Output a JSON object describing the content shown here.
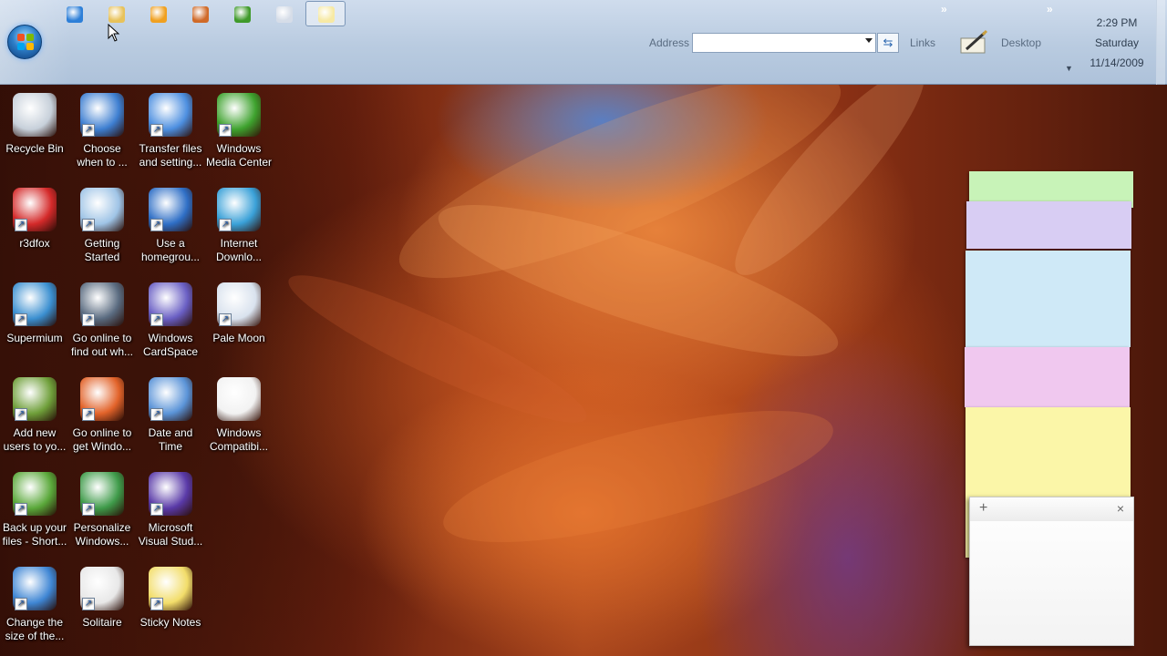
{
  "taskbar": {
    "quick_launch": [
      {
        "icon": "internet-explorer-icon",
        "color": "#2d7fd8"
      },
      {
        "icon": "windows-explorer-icon",
        "color": "#e8c25a"
      },
      {
        "icon": "media-player-icon",
        "color": "#f0a020"
      },
      {
        "icon": "firefox-icon",
        "color": "#d06a28"
      },
      {
        "icon": "media-center-icon",
        "color": "#3f9a2a"
      },
      {
        "icon": "pale-moon-icon",
        "color": "#d6dde8"
      },
      {
        "icon": "sticky-notes-icon",
        "color": "#f0d85a"
      }
    ],
    "address_label": "Address",
    "address_value": "",
    "links_label": "Links",
    "desktop_label": "Desktop",
    "chevron": "»",
    "clock": {
      "time": "2:29 PM",
      "day": "Saturday",
      "date": "11/14/2009"
    }
  },
  "desktop_icons": [
    {
      "label": "Recycle Bin",
      "icon": "recycle-bin-icon",
      "color": "#c7d0da",
      "shortcut": false
    },
    {
      "label": "Choose\nwhen to ...",
      "icon": "security-shield-icon",
      "color": "#3e7fd1",
      "shortcut": true
    },
    {
      "label": "Transfer files\nand setting...",
      "icon": "transfer-files-icon",
      "color": "#4d8fe0",
      "shortcut": true
    },
    {
      "label": "Windows\nMedia Center",
      "icon": "media-center-icon",
      "color": "#3ea22e",
      "shortcut": true
    },
    {
      "label": "r3dfox",
      "icon": "r3dfox-icon",
      "color": "#d42a2a",
      "shortcut": true
    },
    {
      "label": "Getting\nStarted",
      "icon": "getting-started-icon",
      "color": "#9fc4e6",
      "shortcut": true
    },
    {
      "label": "Use a\nhomegrou...",
      "icon": "homegroup-icon",
      "color": "#2f6fc6",
      "shortcut": true
    },
    {
      "label": "Internet\nDownlo...",
      "icon": "internet-download-icon",
      "color": "#3aa1d8",
      "shortcut": true
    },
    {
      "label": "Supermium",
      "icon": "supermium-icon",
      "color": "#3b8fd0",
      "shortcut": true
    },
    {
      "label": "Go online to\nfind out wh...",
      "icon": "whats-new-icon",
      "color": "#5a6b80",
      "shortcut": true
    },
    {
      "label": "Windows\nCardSpace",
      "icon": "cardspace-icon",
      "color": "#6a5fc4",
      "shortcut": true
    },
    {
      "label": "Pale Moon",
      "icon": "pale-moon-icon",
      "color": "#d9e2ee",
      "shortcut": true
    },
    {
      "label": "Add new\nusers to yo...",
      "icon": "add-users-icon",
      "color": "#6f9f3a",
      "shortcut": true
    },
    {
      "label": "Go online to\nget Windo...",
      "icon": "windows-logo-icon",
      "color": "#e2632a",
      "shortcut": true
    },
    {
      "label": "Date and\nTime",
      "icon": "date-time-icon",
      "color": "#5b94d8",
      "shortcut": true
    },
    {
      "label": "Windows\nCompatibi...",
      "icon": "document-icon",
      "color": "#f2f2f2",
      "shortcut": false
    },
    {
      "label": "Back up your\nfiles - Short...",
      "icon": "backup-icon",
      "color": "#5aa83a",
      "shortcut": true
    },
    {
      "label": "Personalize\nWindows...",
      "icon": "personalize-icon",
      "color": "#3f9b4a",
      "shortcut": true
    },
    {
      "label": "Microsoft\nVisual Stud...",
      "icon": "visual-studio-icon",
      "color": "#5a3aa8",
      "shortcut": true
    },
    {
      "label": "",
      "icon": "",
      "color": "",
      "shortcut": false
    },
    {
      "label": "Change the\nsize of the...",
      "icon": "display-size-icon",
      "color": "#3f86d4",
      "shortcut": true
    },
    {
      "label": "Solitaire",
      "icon": "solitaire-icon",
      "color": "#e8e8e8",
      "shortcut": true
    },
    {
      "label": "Sticky Notes",
      "icon": "sticky-notes-icon",
      "color": "#f2dd6a",
      "shortcut": true
    }
  ],
  "sticky_notes": {
    "stack_colors": [
      "#c8f3b8",
      "#d8cdf3",
      "#cfe9f7",
      "#f0c8ef",
      "#fbf6a8"
    ],
    "main_note": {
      "text": "",
      "add_label": "+",
      "close_label": "×"
    }
  }
}
